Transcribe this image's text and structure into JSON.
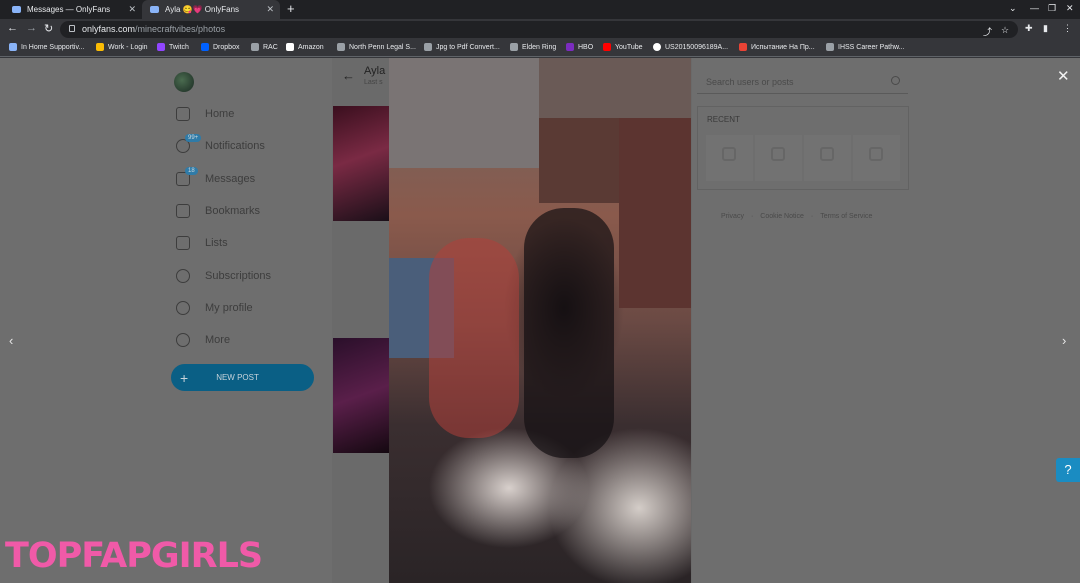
{
  "browser": {
    "tabs": [
      {
        "title": "Messages — OnlyFans",
        "active": false
      },
      {
        "title": "Ayla 😋💗 OnlyFans",
        "active": true
      }
    ],
    "url_domain": "onlyfans.com",
    "url_path": "/minecraftvibes/photos",
    "bookmarks": [
      {
        "label": "In Home Supportiv...",
        "color": "#8ab4f8"
      },
      {
        "label": "Work - Login",
        "color": "#fbbc04"
      },
      {
        "label": "Twitch",
        "color": "#9146ff"
      },
      {
        "label": "Dropbox",
        "color": "#0061ff"
      },
      {
        "label": "RAC",
        "color": "#9aa0a6"
      },
      {
        "label": "Amazon",
        "color": "#ffffff"
      },
      {
        "label": "North Penn Legal S...",
        "color": "#9aa0a6"
      },
      {
        "label": "Jpg to Pdf Convert...",
        "color": "#9aa0a6"
      },
      {
        "label": "Elden Ring",
        "color": "#9aa0a6"
      },
      {
        "label": "HBO",
        "color": "#7b2cbf"
      },
      {
        "label": "YouTube",
        "color": "#ff0000"
      },
      {
        "label": "US20150096189A...",
        "color": "#ffffff"
      },
      {
        "label": "Испытание На Пр...",
        "color": "#ea4335"
      },
      {
        "label": "IHSS Career Pathw...",
        "color": "#9aa0a6"
      }
    ]
  },
  "sidebar": {
    "items": [
      {
        "label": "Home",
        "icon": "home-icon"
      },
      {
        "label": "Notifications",
        "icon": "bell-icon",
        "badge": "99+"
      },
      {
        "label": "Messages",
        "icon": "chat-icon",
        "badge": "18"
      },
      {
        "label": "Bookmarks",
        "icon": "bookmark-icon"
      },
      {
        "label": "Lists",
        "icon": "list-icon"
      },
      {
        "label": "Subscriptions",
        "icon": "user-plus-icon"
      },
      {
        "label": "My profile",
        "icon": "profile-icon"
      },
      {
        "label": "More",
        "icon": "more-icon"
      }
    ],
    "new_post": "NEW POST"
  },
  "profile": {
    "name": "Ayla",
    "subtitle": "Last s"
  },
  "right": {
    "search_placeholder": "Search users or posts",
    "recent_label": "RECENT",
    "footer": [
      "Privacy",
      "Cookie Notice",
      "Terms of Service"
    ]
  },
  "watermark": "TOPFAPGIRLS",
  "colors": {
    "accent": "#0a5f85",
    "watermark": "#f05aa8",
    "help": "#1a8cc2"
  }
}
